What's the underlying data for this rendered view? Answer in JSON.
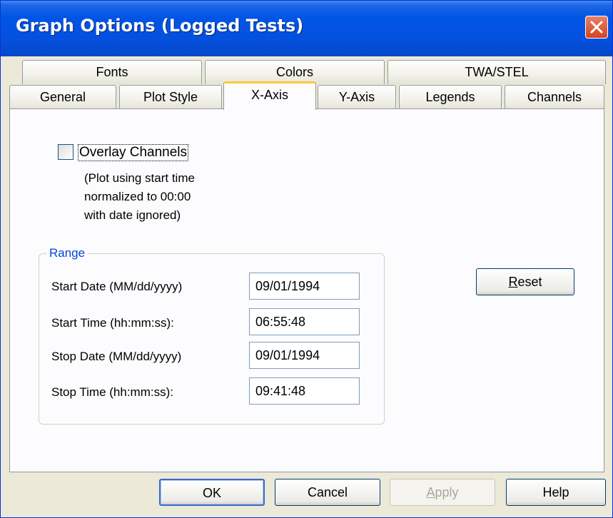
{
  "window": {
    "title": "Graph Options (Logged Tests)"
  },
  "tabs": {
    "row1": [
      {
        "label": "Fonts"
      },
      {
        "label": "Colors"
      },
      {
        "label": "TWA/STEL"
      }
    ],
    "row2": [
      {
        "label": "General"
      },
      {
        "label": "Plot Style"
      },
      {
        "label": "X-Axis",
        "active": true
      },
      {
        "label": "Y-Axis"
      },
      {
        "label": "Legends"
      },
      {
        "label": "Channels"
      }
    ]
  },
  "overlay": {
    "label": "Overlay Channels",
    "checked": false,
    "note_lines": [
      "(Plot using start time",
      "normalized to 00:00",
      "with date ignored)"
    ]
  },
  "range": {
    "title": "Range",
    "start_date_label": "Start Date (MM/dd/yyyy)",
    "start_date_value": "09/01/1994",
    "start_time_label": "Start Time (hh:mm:ss):",
    "start_time_value": "06:55:48",
    "stop_date_label": "Stop Date (MM/dd/yyyy)",
    "stop_date_value": "09/01/1994",
    "stop_time_label": "Stop Time (hh:mm:ss):",
    "stop_time_value": "09:41:48"
  },
  "buttons": {
    "reset_first": "R",
    "reset_rest": "eset",
    "ok": "OK",
    "cancel": "Cancel",
    "apply_first": "A",
    "apply_rest": "pply",
    "help": "Help"
  },
  "colors": {
    "titlebar": "#0055e5",
    "active_tab_accent": "#ffc83c",
    "group_title": "#0046d5"
  }
}
